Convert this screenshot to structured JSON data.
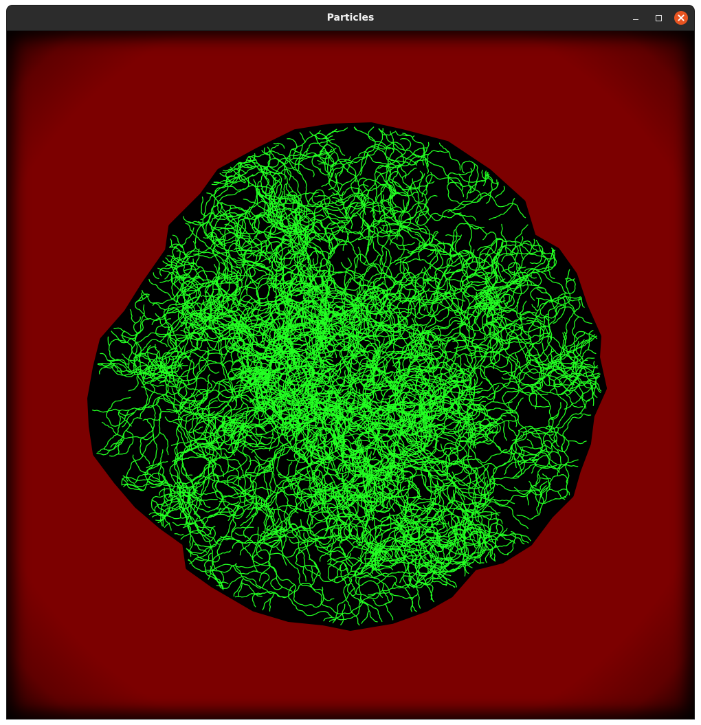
{
  "window": {
    "title": "Particles"
  },
  "controls": {
    "minimize_icon": "minimize-icon",
    "maximize_icon": "maximize-icon",
    "close_icon": "close-icon"
  },
  "simulation": {
    "background_color": "#7c0000",
    "cluster_fill_color": "#000000",
    "particle_color": "#22ff22",
    "accent_close_color": "#e95420"
  }
}
